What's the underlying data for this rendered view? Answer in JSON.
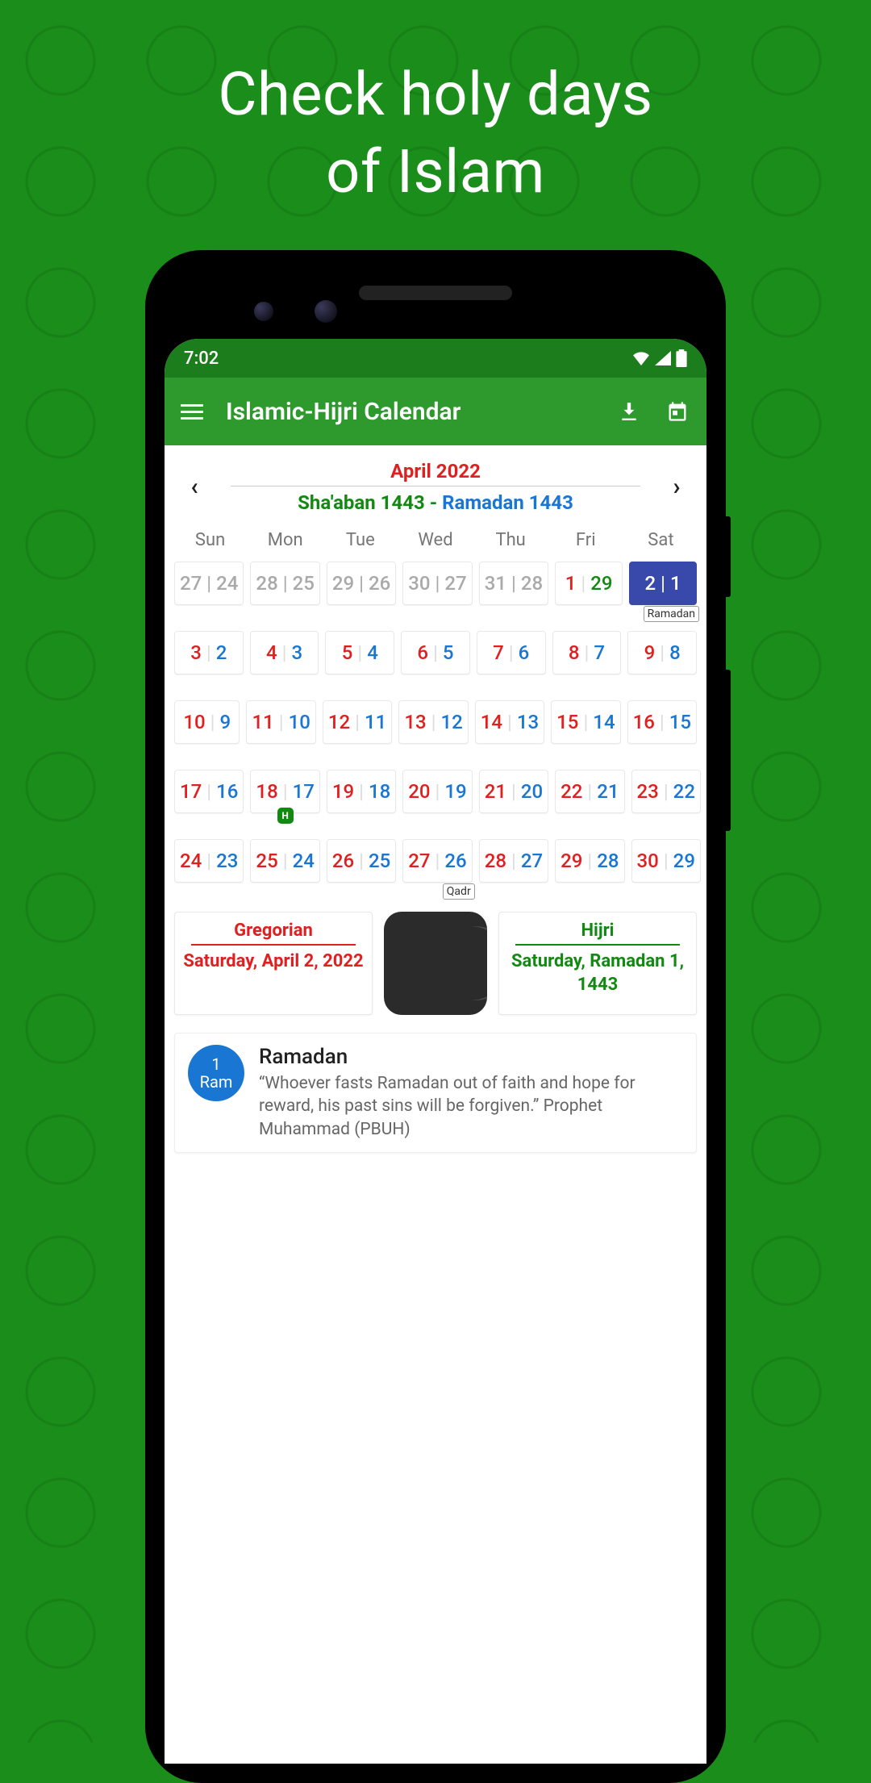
{
  "headline_l1": "Check holy days",
  "headline_l2": "of Islam",
  "status": {
    "time": "7:02"
  },
  "appbar": {
    "title": "Islamic-Hijri Calendar"
  },
  "nav": {
    "gregorian_month": "April 2022",
    "hijri_a": "Sha'aban 1443",
    "hijri_sep": " - ",
    "hijri_b": "Ramadan 1443"
  },
  "dow": [
    "Sun",
    "Mon",
    "Tue",
    "Wed",
    "Thu",
    "Fri",
    "Sat"
  ],
  "weeks": [
    [
      {
        "g": "27",
        "h": "24",
        "out": true
      },
      {
        "g": "28",
        "h": "25",
        "out": true
      },
      {
        "g": "29",
        "h": "26",
        "out": true
      },
      {
        "g": "30",
        "h": "27",
        "out": true
      },
      {
        "g": "31",
        "h": "28",
        "out": true
      },
      {
        "g": "1",
        "h": "29",
        "fri": true
      },
      {
        "g": "2",
        "h": "1",
        "highlight": true,
        "tag": "Ramadan"
      }
    ],
    [
      {
        "g": "3",
        "h": "2"
      },
      {
        "g": "4",
        "h": "3"
      },
      {
        "g": "5",
        "h": "4"
      },
      {
        "g": "6",
        "h": "5"
      },
      {
        "g": "7",
        "h": "6"
      },
      {
        "g": "8",
        "h": "7"
      },
      {
        "g": "9",
        "h": "8"
      }
    ],
    [
      {
        "g": "10",
        "h": "9"
      },
      {
        "g": "11",
        "h": "10"
      },
      {
        "g": "12",
        "h": "11"
      },
      {
        "g": "13",
        "h": "12"
      },
      {
        "g": "14",
        "h": "13"
      },
      {
        "g": "15",
        "h": "14"
      },
      {
        "g": "16",
        "h": "15"
      }
    ],
    [
      {
        "g": "17",
        "h": "16"
      },
      {
        "g": "18",
        "h": "17",
        "badge": "H"
      },
      {
        "g": "19",
        "h": "18"
      },
      {
        "g": "20",
        "h": "19"
      },
      {
        "g": "21",
        "h": "20"
      },
      {
        "g": "22",
        "h": "21"
      },
      {
        "g": "23",
        "h": "22"
      }
    ],
    [
      {
        "g": "24",
        "h": "23"
      },
      {
        "g": "25",
        "h": "24"
      },
      {
        "g": "26",
        "h": "25"
      },
      {
        "g": "27",
        "h": "26",
        "tag": "Qadr"
      },
      {
        "g": "28",
        "h": "27"
      },
      {
        "g": "29",
        "h": "28"
      },
      {
        "g": "30",
        "h": "29"
      }
    ]
  ],
  "date_boxes": {
    "greg_label": "Gregorian",
    "greg_value": "Saturday, April 2, 2022",
    "hijri_label": "Hijri",
    "hijri_value": "Saturday, Ramadan 1, 1443"
  },
  "event": {
    "badge_top": "1",
    "badge_bottom": "Ram",
    "title": "Ramadan",
    "body": "“Whoever fasts Ramadan out of faith and hope for reward, his past sins will be forgiven.” Prophet Muhammad (PBUH)"
  }
}
